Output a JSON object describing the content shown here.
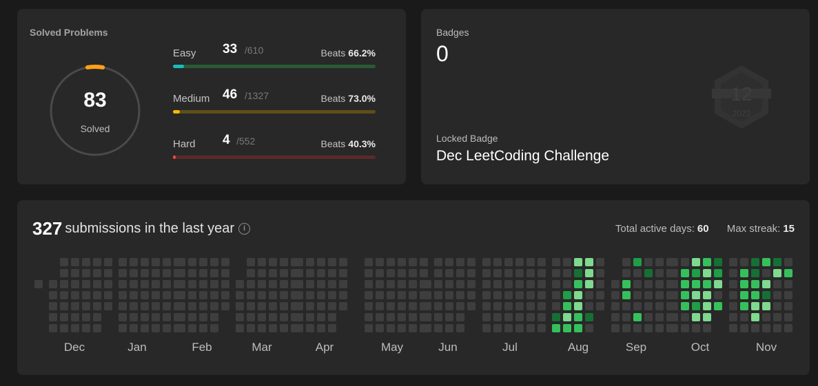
{
  "solved": {
    "title": "Solved Problems",
    "total": "83",
    "total_label": "Solved",
    "rows": [
      {
        "label": "Easy",
        "count": "33",
        "total": "/610",
        "beats_label": "Beats",
        "beats": "66.2%",
        "fraction": 0.054,
        "color": "#2cbb5d",
        "fill_color": "#1cbaba"
      },
      {
        "label": "Medium",
        "count": "46",
        "total": "/1327",
        "beats_label": "Beats",
        "beats": "73.0%",
        "fraction": 0.035,
        "color": "#ffb800",
        "fill_color": "#ffb800"
      },
      {
        "label": "Hard",
        "count": "4",
        "total": "/552",
        "beats_label": "Beats",
        "beats": "40.3%",
        "fraction": 0.007,
        "color": "#ef4743",
        "fill_color": "#ef4743"
      }
    ]
  },
  "badges": {
    "title": "Badges",
    "count": "0",
    "locked_title": "Locked Badge",
    "locked_name": "Dec LeetCoding Challenge",
    "badge_month": "12",
    "badge_year": "2022"
  },
  "submissions": {
    "count": "327",
    "text": "submissions in the last year",
    "active_label": "Total active days:",
    "active_value": "60",
    "streak_label": "Max streak:",
    "streak_value": "15",
    "months": [
      "Dec",
      "Jan",
      "Feb",
      "Mar",
      "Apr",
      "May",
      "Jun",
      "Jul",
      "Aug",
      "Sep",
      "Oct",
      "Nov"
    ],
    "colors": {
      "empty": "#3e3e3e",
      "l1": "#166f35",
      "l2": "#1f9d47",
      "l3": "#36c05c",
      "l4": "#7fd98e"
    }
  }
}
